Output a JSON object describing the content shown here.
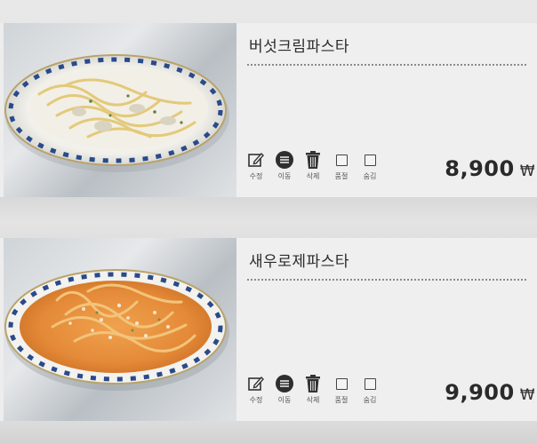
{
  "menu_items": [
    {
      "name": "버섯크림파스타",
      "price": "8,900",
      "currency": "₩",
      "photo_icon": "cream-pasta-photo"
    },
    {
      "name": "새우로제파스타",
      "price": "9,900",
      "currency": "₩",
      "photo_icon": "rose-pasta-photo"
    }
  ],
  "actions": {
    "edit": {
      "label": "수정",
      "icon": "edit-icon"
    },
    "move": {
      "label": "이동",
      "icon": "move-icon"
    },
    "delete": {
      "label": "삭제",
      "icon": "trash-icon"
    },
    "soldout": {
      "label": "품절",
      "icon": "checkbox"
    },
    "hide": {
      "label": "숨김",
      "icon": "checkbox"
    }
  },
  "colors": {
    "cream_sauce": "#f2efe6",
    "rose_sauce": "#e8903e",
    "plate_rim": "#2a4a8c",
    "text": "#2b2b2b"
  }
}
